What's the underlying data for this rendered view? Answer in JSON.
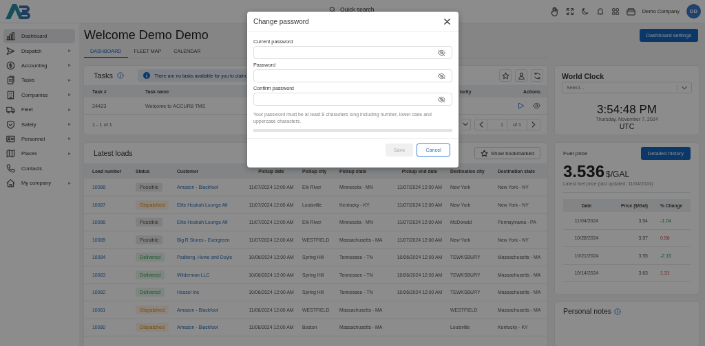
{
  "topbar": {
    "search_placeholder": "Quick search",
    "company": "Demo Company",
    "avatar_initials": "DD"
  },
  "sidebar": {
    "items": [
      {
        "label": "Dashboard",
        "selected": true,
        "expandable": false
      },
      {
        "label": "Dispatch",
        "selected": false,
        "expandable": true
      },
      {
        "label": "Accounting",
        "selected": false,
        "expandable": true
      },
      {
        "label": "Tasks",
        "selected": false,
        "expandable": true
      },
      {
        "label": "Companies",
        "selected": false,
        "expandable": true
      },
      {
        "label": "Fleet",
        "selected": false,
        "expandable": true
      },
      {
        "label": "Safety",
        "selected": false,
        "expandable": true
      },
      {
        "label": "Personnel",
        "selected": false,
        "expandable": true
      },
      {
        "label": "Places",
        "selected": false,
        "expandable": true
      },
      {
        "label": "Contacts",
        "selected": false,
        "expandable": false
      },
      {
        "label": "My company",
        "selected": false,
        "expandable": true
      }
    ]
  },
  "page": {
    "title": "Welcome Demo Demo",
    "settings_button": "Dashboard settings",
    "tabs": [
      {
        "label": "DASHBOARD",
        "selected": true
      },
      {
        "label": "FLEET MAP",
        "selected": false
      },
      {
        "label": "CALENDAR",
        "selected": false
      }
    ]
  },
  "tasks": {
    "title": "Tasks",
    "notice": "There are no tasks available for you to claim.",
    "columns": [
      "Task #",
      "Task name",
      "iority",
      "Actions"
    ],
    "rows": [
      {
        "task_no": "24423",
        "name": "Welcome to ACCUR8 TMS"
      }
    ],
    "range": "1 - 1 of 1",
    "page": "1",
    "page_of": "of 1"
  },
  "loads": {
    "title": "Latest loads",
    "bookmark_button": "Show bookmarked",
    "columns": [
      "Load number",
      "Status",
      "Customer",
      "Pickup date",
      "Pickup city",
      "Pickup state",
      "Pickup end date",
      "Destination city",
      "Destination state"
    ],
    "rows": [
      {
        "load_number": "10088",
        "status": {
          "label": "Possible",
          "kind": "possible"
        },
        "customer": "Amazon - Blackfoot",
        "pickup_date": "11/07/2024 12:00 AM",
        "pickup_city": "Elk River",
        "pickup_state": "Minnesota - MN",
        "pickup_end_date": "11/07/2024 12:00 AM",
        "destination_city": "New York",
        "destination_state": "New York - NY"
      },
      {
        "load_number": "10087",
        "status": {
          "label": "Dispatched",
          "kind": "dispatched"
        },
        "customer": "Elite Hookah Lounge Atl",
        "pickup_date": "11/07/2024 12:00 AM",
        "pickup_city": "Louisville",
        "pickup_state": "Kentucky - KY",
        "pickup_end_date": "11/07/2024 12:00 AM",
        "destination_city": "New York",
        "destination_state": "New York - NY"
      },
      {
        "load_number": "10086",
        "status": {
          "label": "Possible",
          "kind": "possible"
        },
        "customer": "Elite Hookah Lounge Atl",
        "pickup_date": "11/07/2024 12:00 AM",
        "pickup_city": "Elk River",
        "pickup_state": "Minnesota - MN",
        "pickup_end_date": "11/07/2024 12:00 AM",
        "destination_city": "McDonald",
        "destination_state": "Pennsylvania - PA"
      },
      {
        "load_number": "10085",
        "status": {
          "label": "Possible",
          "kind": "possible"
        },
        "customer": "Big R Stores - Evergreen",
        "pickup_date": "11/07/2024 12:00 AM",
        "pickup_city": "WESTFIELD",
        "pickup_state": "Massachusetts - MA",
        "pickup_end_date": "11/07/2024 12:00 AM",
        "destination_city": "New York",
        "destination_state": "New York - NY"
      },
      {
        "load_number": "10084",
        "status": {
          "label": "Delivered",
          "kind": "delivered"
        },
        "customer": "Padberg, Howe and Doyle",
        "pickup_date": "10/06/2024 12:00 AM",
        "pickup_city": "Spring Hill",
        "pickup_state": "Tennessee - TN",
        "pickup_end_date": "10/06/2024 12:00 AM",
        "destination_city": "TEWKSBURY",
        "destination_state": "Massachusetts - MA"
      },
      {
        "load_number": "10083",
        "status": {
          "label": "Delivered",
          "kind": "delivered"
        },
        "customer": "Wilderman LLC",
        "pickup_date": "10/06/2024 12:00 AM",
        "pickup_city": "Spring Hill",
        "pickup_state": "Tennessee - TN",
        "pickup_end_date": "10/06/2024 12:00 AM",
        "destination_city": "TEWKSBURY",
        "destination_state": "Massachusetts - MA"
      },
      {
        "load_number": "10082",
        "status": {
          "label": "Delivered",
          "kind": "delivered"
        },
        "customer": "Hessel Inc",
        "pickup_date": "10/06/2024 12:00 AM",
        "pickup_city": "Spring Hill",
        "pickup_state": "Tennessee - TN",
        "pickup_end_date": "10/06/2024 12:00 AM",
        "destination_city": "TEWKSBURY",
        "destination_state": "Massachusetts - MA"
      },
      {
        "load_number": "10081",
        "status": {
          "label": "Dispatched",
          "kind": "dispatched"
        },
        "customer": "Amazon - Blackfoot",
        "pickup_date": "11/06/2024 12:00 AM",
        "pickup_city": "WESTFIELD",
        "pickup_state": "Massachusetts - MA",
        "destination_city": "WESTFIELD",
        "destination_state": "Massachusetts - MA"
      },
      {
        "load_number": "10080",
        "status": {
          "label": "Dispatched",
          "kind": "dispatched"
        },
        "customer": "Amazon - Blackfoot",
        "pickup_date": "11/06/2024 12:00 AM",
        "pickup_city": "Boston",
        "pickup_state": "Massachusetts - MA",
        "destination_city": "Louisville",
        "destination_state": "Kentucky - KY"
      }
    ]
  },
  "world_clock": {
    "title": "World Clock",
    "select_placeholder": "Select...",
    "time": "3:54:48 PM",
    "date": "Thursday, November 7, 2024",
    "zone": "UTC"
  },
  "fuel": {
    "title": "Fuel price",
    "history_button": "Detailed history",
    "price": "3.536",
    "unit": "$/GAL",
    "caption": "Latest fuel price (last updated: 11/04/2024)",
    "columns": [
      "Date",
      "Price ($/Gal)",
      "% Change"
    ],
    "rows": [
      {
        "date": "11/04/2024",
        "price": "3.54",
        "change": "-1.04",
        "kind": "decrease"
      },
      {
        "date": "10/28/2024",
        "price": "3.57",
        "change": "0.56",
        "kind": "increase"
      },
      {
        "date": "10/21/2024",
        "price": "3.55",
        "change": "-2.15",
        "kind": "decrease"
      },
      {
        "date": "10/14/2024",
        "price": "3.63",
        "change": "1.31",
        "kind": "increase"
      }
    ]
  },
  "notes": {
    "title": "Personal notes"
  },
  "modal": {
    "title": "Change password",
    "fields": [
      {
        "label": "Current password"
      },
      {
        "label": "Password"
      },
      {
        "label": "Confirm password"
      }
    ],
    "hint": "Your password must be at least 8 characters long including number, lower case and uppercase characters.",
    "strength": {
      "level": 0
    },
    "buttons": [
      {
        "label": "Save",
        "kind": "secondary",
        "disabled": true
      },
      {
        "label": "Cancel",
        "kind": "outline",
        "disabled": false
      }
    ]
  }
}
